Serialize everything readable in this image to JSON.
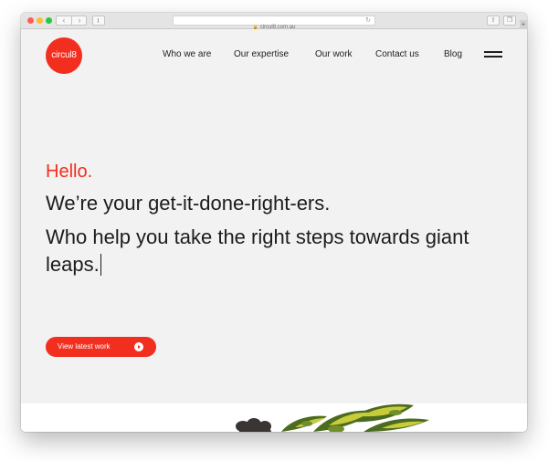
{
  "browser": {
    "url": "circul8.com.au",
    "back_icon": "chevron-left-icon",
    "forward_icon": "chevron-right-icon",
    "sidebar_icon": "sidebar-icon",
    "lock_icon": "lock-icon",
    "reload_icon": "reload-icon",
    "share_icon": "share-icon",
    "tabs_icon": "tabs-icon",
    "new_tab": "+"
  },
  "site": {
    "logo_text": "circul8",
    "brand_color": "#f22e1f",
    "nav": [
      {
        "label": "Who we are"
      },
      {
        "label": "Our expertise"
      },
      {
        "label": "Our work"
      },
      {
        "label": "Contact us"
      },
      {
        "label": "Blog"
      }
    ],
    "menu_icon": "hamburger-menu-icon"
  },
  "hero": {
    "hello": "Hello.",
    "line1": "We’re your get-it-done-right-ers.",
    "line2": "Who help you take the right steps towards giant leaps."
  },
  "cta": {
    "label": "View latest work",
    "icon": "play-circle-icon"
  }
}
